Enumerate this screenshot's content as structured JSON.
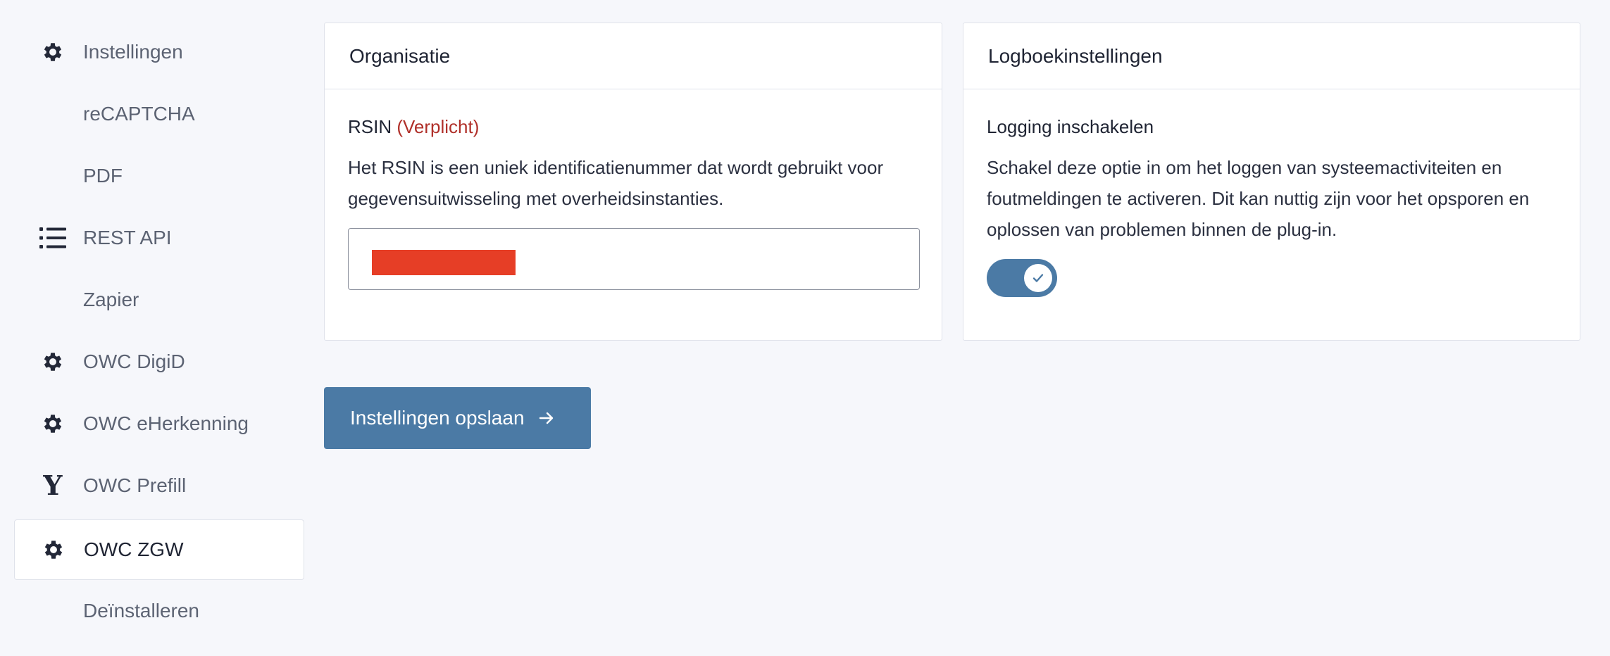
{
  "sidebar": {
    "items": [
      {
        "label": "Instellingen",
        "icon": "gear-icon"
      },
      {
        "label": "reCAPTCHA",
        "icon": ""
      },
      {
        "label": "PDF",
        "icon": ""
      },
      {
        "label": "REST API",
        "icon": "list-icon"
      },
      {
        "label": "Zapier",
        "icon": ""
      },
      {
        "label": "OWC DigiD",
        "icon": "gear-icon"
      },
      {
        "label": "OWC eHerkenning",
        "icon": "gear-icon"
      },
      {
        "label": "OWC Prefill",
        "icon": "y-logo-icon"
      },
      {
        "label": "OWC ZGW",
        "icon": "gear-icon",
        "active": true
      },
      {
        "label": "Deïnstalleren",
        "icon": ""
      }
    ]
  },
  "organisation_card": {
    "title": "Organisatie",
    "field_label": "RSIN",
    "required_label": "(Verplicht)",
    "description": "Het RSIN is een uniek identificatienummer dat wordt gebruikt voor gegevensuitwisseling met overheidsinstanties."
  },
  "logging_card": {
    "title": "Logboekinstellingen",
    "field_label": "Logging inschakelen",
    "description": "Schakel deze optie in om het loggen van systeemactiviteiten en foutmeldingen te activeren. Dit kan nuttig zijn voor het opsporen en oplossen van problemen binnen de plug-in.",
    "toggle_on": true
  },
  "save_button": {
    "label": "Instellingen opslaan"
  },
  "colors": {
    "accent": "#4b7aa5",
    "required": "#b0302a",
    "redaction": "#e63e26",
    "background": "#f6f7fb"
  }
}
